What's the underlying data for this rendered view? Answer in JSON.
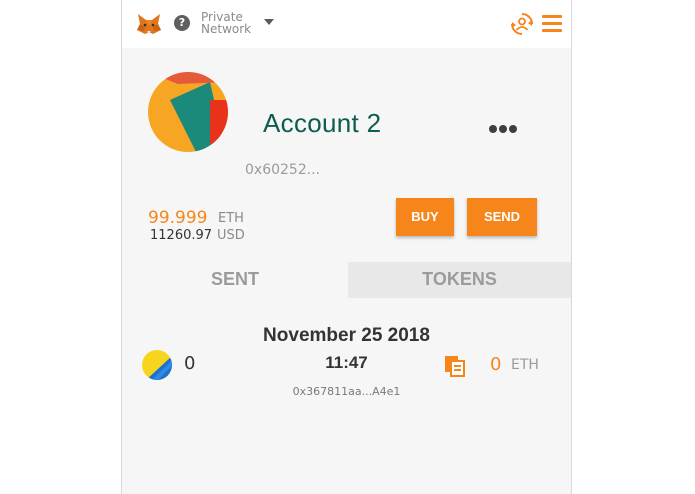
{
  "header": {
    "network_line1": "Private",
    "network_line2": "Network",
    "help_glyph": "?",
    "icons": [
      "metamask-fox-icon",
      "network-help-icon",
      "chevron-down-icon",
      "account-switch-icon",
      "hamburger-menu-icon"
    ]
  },
  "account": {
    "name": "Account 2",
    "address": "0x60252...",
    "eth_balance": "99.999",
    "eth_unit": "ETH",
    "usd_balance": "11260.97",
    "usd_unit": "USD"
  },
  "actions": {
    "buy_label": "BUY",
    "send_label": "SEND"
  },
  "tabs": [
    {
      "label": "SENT",
      "active": true
    },
    {
      "label": "TOKENS",
      "active": false
    }
  ],
  "transaction": {
    "date": "November 25 2018",
    "time": "11:47",
    "hash": "0x367811aa...A4e1",
    "value": "0",
    "eth_amount": "0",
    "eth_unit": "ETH"
  },
  "colors": {
    "accent": "#f6851b",
    "account_name": "#0d5c4d",
    "tab_inactive_bg": "#e8e8e8"
  }
}
